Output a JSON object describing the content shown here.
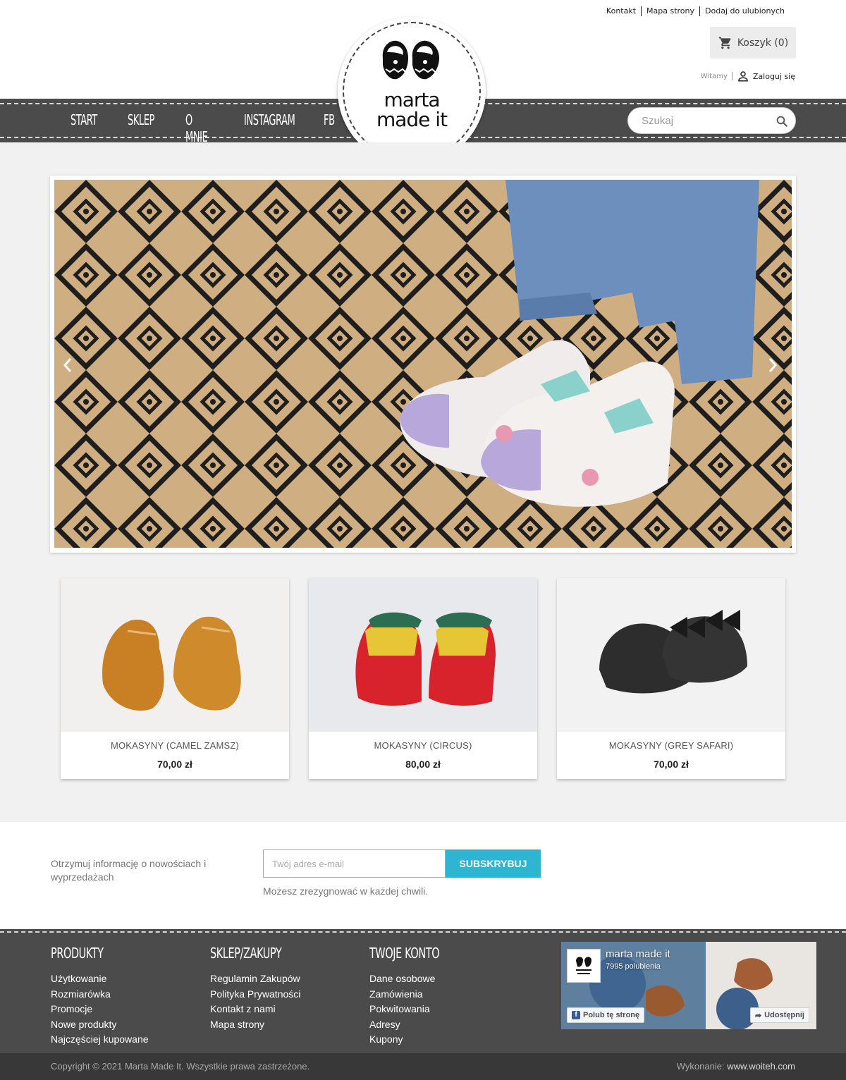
{
  "header": {
    "top_links": [
      "Kontakt",
      "Mapa strony",
      "Dodaj do ulubionych"
    ],
    "cart_label": "Koszyk (0)",
    "greeting": "Witamy",
    "login_label": "Zaloguj się"
  },
  "logo": {
    "line1": "marta",
    "line2": "made it"
  },
  "nav": {
    "items": [
      "START",
      "SKLEP",
      "O MNIE",
      "INSTAGRAM",
      "FB"
    ],
    "search_placeholder": "Szukaj"
  },
  "products": [
    {
      "name": "MOKASYNY (CAMEL ZAMSZ)",
      "price": "70,00 zł"
    },
    {
      "name": "MOKASYNY (CIRCUS)",
      "price": "80,00 zł"
    },
    {
      "name": "MOKASYNY (GREY SAFARI)",
      "price": "70,00 zł"
    }
  ],
  "newsletter": {
    "text": "Otrzymuj informację o nowościach i wyprzedażach",
    "placeholder": "Twój adres e-mail",
    "button": "SUBSKRYBUJ",
    "note": "Możesz zrezygnować w każdej chwili."
  },
  "footer": {
    "columns": [
      {
        "title": "PRODUKTY",
        "links": [
          "Użytkowanie",
          "Rozmiarówka",
          "Promocje",
          "Nowe produkty",
          "Najczęściej kupowane"
        ]
      },
      {
        "title": "SKLEP/ZAKUPY",
        "links": [
          "Regulamin Zakupów",
          "Polityka Prywatności",
          "Kontakt z nami",
          "Mapa strony"
        ]
      },
      {
        "title": "TWOJE KONTO",
        "links": [
          "Dane osobowe",
          "Zamówienia",
          "Pokwitowania",
          "Adresy",
          "Kupony"
        ]
      }
    ],
    "facebook": {
      "page_name": "marta made it",
      "likes": "7995 polubienia",
      "like_button": "Polub tę stronę",
      "share_button": "Udostępnij"
    },
    "copyright": "Copyright © 2021 Marta Made It. Wszystkie prawa zastrzeżone.",
    "credit_prefix": "Wykonanie:",
    "credit_link": "www.woiteh.com"
  },
  "colors": {
    "nav_bg": "#4b4b4b",
    "main_bg": "#f1f1f1",
    "accent": "#2fb5d2",
    "bottom_bar": "#383838"
  }
}
